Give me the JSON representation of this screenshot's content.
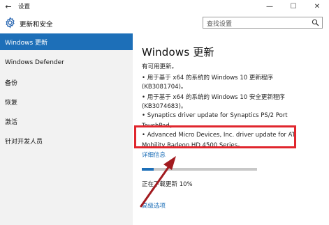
{
  "window": {
    "title": "设置",
    "back_glyph": "←",
    "min_glyph": "—",
    "max_glyph": "☐",
    "close_glyph": "✕"
  },
  "header": {
    "app_title": "更新和安全",
    "search_placeholder": "查找设置",
    "icons": [
      "gear-icon",
      "search-icon"
    ]
  },
  "sidebar": {
    "items": [
      {
        "label": "Windows 更新",
        "active": true
      },
      {
        "label": "Windows Defender",
        "active": false
      },
      {
        "label": "备份",
        "active": false
      },
      {
        "label": "恢复",
        "active": false
      },
      {
        "label": "激活",
        "active": false
      },
      {
        "label": "针对开发人员",
        "active": false
      }
    ]
  },
  "main": {
    "title": "Windows 更新",
    "status": "有可用更新。",
    "update_lines": [
      "• 用于基于 x64 的系统的 Windows 10 更新程序",
      "(KB3081704)。",
      "• 用于基于 x64 的系统的 Windows 10 安全更新程序",
      "(KB3074683)。",
      "• Synaptics driver update for Synaptics PS/2 Port",
      "TouchPad。",
      "• Advanced Micro Devices, Inc. driver update for AT",
      "Mobility Radeon HD 4500 Series。"
    ],
    "detail_link": "详细信息",
    "progress_fraction": 0.1,
    "download_status": "正在下载更新 10%",
    "advanced_link": "高级选项"
  },
  "colors": {
    "accent": "#1d6fb8",
    "highlight": "#e0262d",
    "sidebar_bg": "#f2f2f2"
  }
}
